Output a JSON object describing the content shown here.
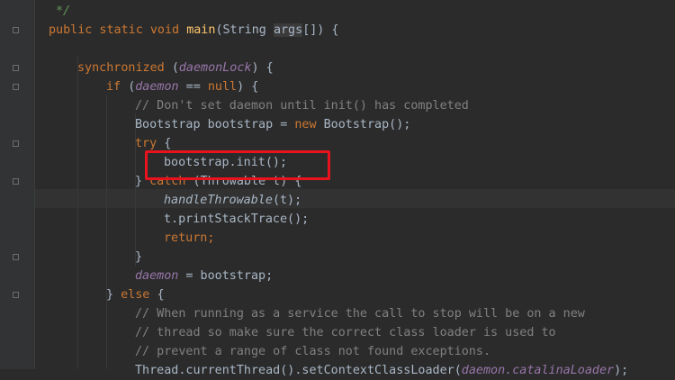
{
  "code": {
    "l0": "*/",
    "l1": {
      "kw": "public static void ",
      "fn": "main",
      "rest1": "(String ",
      "param": "args",
      "rest2": "[]) {"
    },
    "l3": {
      "kw": "synchronized ",
      "p1": "(",
      "field": "daemonLock",
      "p2": ") {"
    },
    "l4": {
      "kw": "if ",
      "p1": "(",
      "field": "daemon",
      "op": " == ",
      "kw2": "null",
      "p2": ") {"
    },
    "l5": "// Don't set daemon until init() has completed",
    "l6": {
      "t1": "Bootstrap bootstrap = ",
      "kw": "new ",
      "t2": "Bootstrap();"
    },
    "l7": {
      "kw": "try ",
      "t": "{"
    },
    "l8": "bootstrap.init();",
    "l9": {
      "t1": "} ",
      "kw": "catch ",
      "t2": "(Throwable t) {"
    },
    "l10": {
      "fn": "handleThrowable",
      "t": "(t);"
    },
    "l11": "t.printStackTrace();",
    "l12": "return;",
    "l13": "}",
    "l14": {
      "field": "daemon",
      "t": " = bootstrap;"
    },
    "l15": {
      "t1": "} ",
      "kw": "else ",
      "t2": "{"
    },
    "l16": "// When running as a service the call to stop will be on a new",
    "l17": "// thread so make sure the correct class loader is used to",
    "l18": "// prevent a range of class not found exceptions.",
    "l19": {
      "t1": "Thread.currentThread().setContextClassLoader(",
      "field": "daemon.catalinaLoader",
      "t2": ");"
    }
  },
  "colors": {
    "background": "#2b2b2b",
    "keyword": "#cc7832",
    "comment": "#808080",
    "field": "#9876aa",
    "method": "#ffc66d",
    "highlight": "#e8131d"
  }
}
